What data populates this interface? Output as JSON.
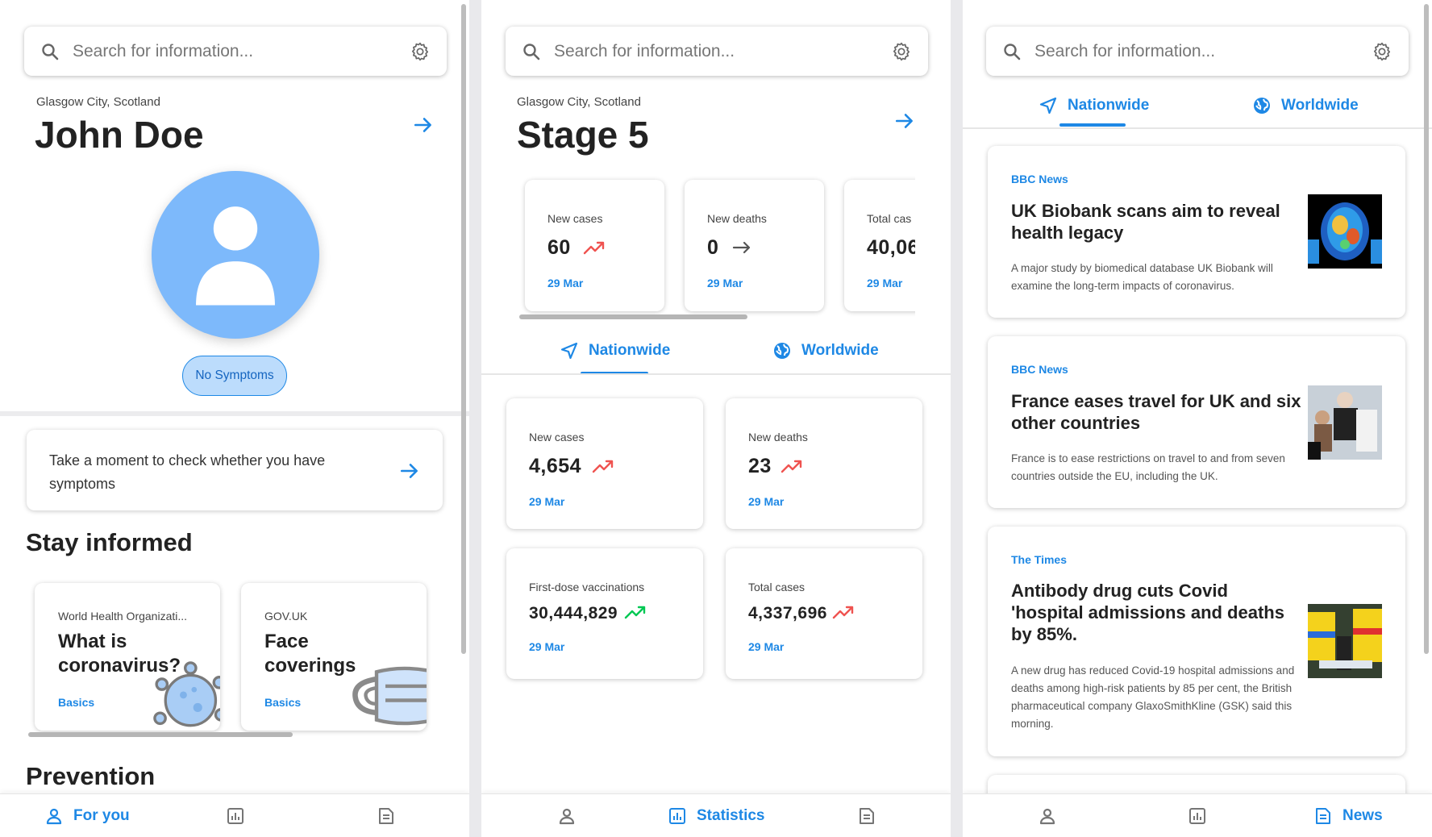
{
  "colors": {
    "accent": "#1e88e5",
    "avatar_bg": "#7db9fb",
    "trend_up_red": "#ef5350",
    "trend_up_green": "#00c853"
  },
  "search": {
    "placeholder": "Search for information..."
  },
  "for_you": {
    "location": "Glasgow City, Scotland",
    "name": "John Doe",
    "status_badge": "No Symptoms",
    "check_prompt": "Take a moment to check whether you have symptoms",
    "stay_informed_title": "Stay informed",
    "info_cards": [
      {
        "source": "World Health Organizati...",
        "title_line1": "What is",
        "title_line2": "coronavirus?",
        "tag": "Basics",
        "icon": "virus-icon"
      },
      {
        "source": "GOV.UK",
        "title_line1": "Face",
        "title_line2": "coverings",
        "tag": "Basics",
        "icon": "mask-icon"
      }
    ],
    "prevention_title": "Prevention"
  },
  "statistics": {
    "location": "Glasgow City, Scotland",
    "stage": "Stage 5",
    "local_cards": [
      {
        "label": "New cases",
        "value": "60",
        "trend": "up",
        "date": "29 Mar"
      },
      {
        "label": "New deaths",
        "value": "0",
        "trend": "flat",
        "date": "29 Mar"
      },
      {
        "label": "Total cas",
        "value": "40,06",
        "date": "29 Mar"
      }
    ],
    "tabs": {
      "nationwide": "Nationwide",
      "worldwide": "Worldwide"
    },
    "national_cards": [
      {
        "label": "New cases",
        "value": "4,654",
        "trend": "up",
        "date": "29 Mar"
      },
      {
        "label": "New deaths",
        "value": "23",
        "trend": "up",
        "date": "29 Mar"
      },
      {
        "label": "First-dose vaccinations",
        "value": "30,444,829",
        "trend": "up-green",
        "date": "29 Mar"
      },
      {
        "label": "Total cases",
        "value": "4,337,696",
        "trend": "up",
        "date": "29 Mar"
      }
    ]
  },
  "news": {
    "tabs": {
      "nationwide": "Nationwide",
      "worldwide": "Worldwide"
    },
    "articles": [
      {
        "source": "BBC News",
        "title": "UK Biobank scans aim to reveal health legacy",
        "description": "A major study by biomedical database UK Biobank will examine the long-term impacts of coronavirus.",
        "thumbnail": "brain-scan-image"
      },
      {
        "source": "BBC News",
        "title": "France eases travel for UK and six other countries",
        "description": "France is to ease restrictions on travel to and from seven countries outside the EU, including the UK.",
        "thumbnail": "airport-travellers-image"
      },
      {
        "source": "The Times",
        "title": "Antibody drug cuts Covid 'hospital admissions and deaths by 85%.",
        "description": "A new drug has reduced Covid-19 hospital admissions and deaths among high-risk patients by 85 per cent, the British pharmaceutical company GlaxoSmithKline (GSK) said this morning.",
        "thumbnail": "ambulance-image"
      }
    ]
  },
  "bottom_nav": {
    "for_you": "For you",
    "statistics": "Statistics",
    "news": "News"
  }
}
